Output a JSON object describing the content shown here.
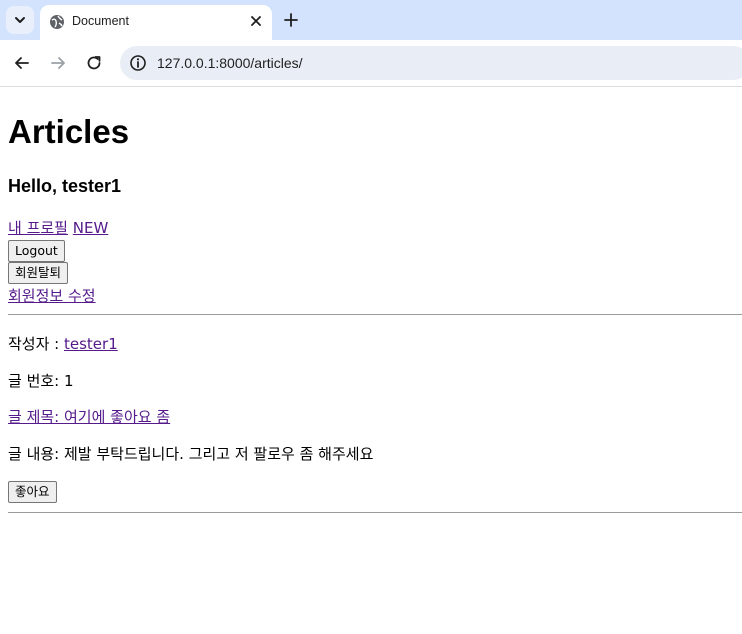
{
  "browser": {
    "tab_title": "Document",
    "url": "127.0.0.1:8000/articles/"
  },
  "page": {
    "heading": "Articles",
    "greeting": "Hello, tester1",
    "links": {
      "profile": "내 프로필",
      "new": "NEW",
      "edit_account": "회원정보 수정"
    },
    "buttons": {
      "logout": "Logout",
      "delete_account": "회원탈퇴"
    },
    "article": {
      "author_label": "작성자 : ",
      "author": "tester1",
      "number": "글 번호: 1",
      "title": "글 제목: 여기에 좋아요 좀",
      "content": "글 내용: 제발 부탁드립니다. 그리고 저 팔로우 좀 해주세요",
      "like_button": "좋아요"
    }
  }
}
